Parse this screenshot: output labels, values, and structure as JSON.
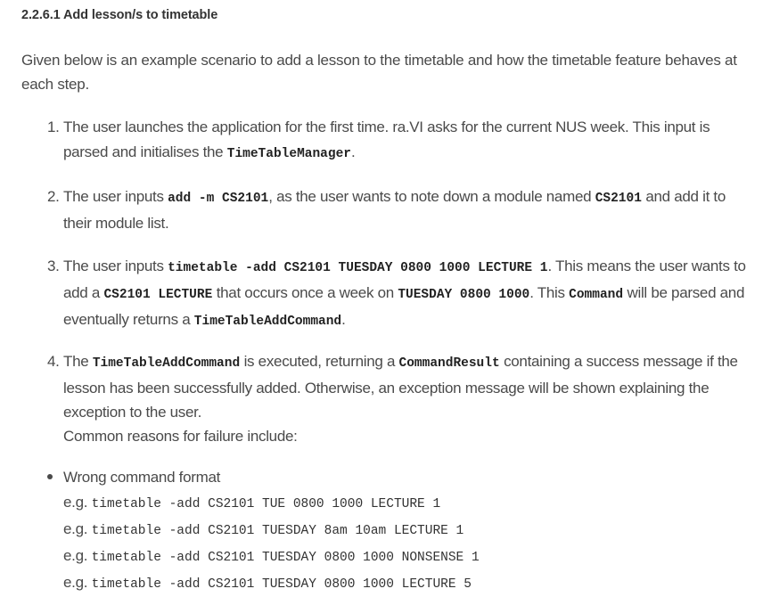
{
  "heading": "2.2.6.1 Add lesson/s to timetable",
  "intro": {
    "line1": "Given below is an example scenario to add a lesson to the timetable and how the timetable feature behaves at",
    "line2": "each step."
  },
  "steps": [
    {
      "num": "1.",
      "l1_text": "The user launches the application for the first time. ra.VI asks for the current NUS week. This input is",
      "l2_pre": "parsed and initialises the ",
      "l2_code": "TimeTableManager",
      "l2_post": "."
    },
    {
      "num": "2.",
      "l1_pre": "The user inputs ",
      "l1_code1": "add -m CS2101",
      "l1_mid": ", as the user wants to note down a module named ",
      "l1_code2": "CS2101",
      "l1_post": " and add it to",
      "l2_text": "their module list."
    },
    {
      "num": "3.",
      "l1_pre": "The user inputs ",
      "l1_code": "timetable -add CS2101 TUESDAY 0800 1000 LECTURE 1",
      "l1_post": ". This means the user wants to",
      "l2_pre": "add a ",
      "l2_code1": "CS2101 LECTURE",
      "l2_mid": " that occurs once a week on ",
      "l2_code2": "TUESDAY 0800 1000",
      "l2_mid2": ". This ",
      "l2_code3": "Command",
      "l2_post": " will be parsed and",
      "l3_pre": "eventually returns a ",
      "l3_code": "TimeTableAddCommand",
      "l3_post": "."
    },
    {
      "num": "4.",
      "l1_pre": "The ",
      "l1_code1": "TimeTableAddCommand",
      "l1_mid": " is executed, returning a ",
      "l1_code2": "CommandResult",
      "l1_post": " containing a success message if the",
      "l2_text": "lesson has been successfully added. Otherwise, an exception message will be shown explaining the",
      "l3_text": "exception to the user.",
      "l4_text": "Common reasons for failure include:"
    }
  ],
  "bullet": {
    "title": "Wrong command format",
    "eg_label": "e.g. ",
    "examples": [
      "timetable -add CS2101 TUE 0800 1000 LECTURE 1",
      "timetable -add CS2101 TUESDAY 8am 10am LECTURE 1",
      "timetable -add CS2101 TUESDAY 0800 1000 NONSENSE 1",
      "timetable -add CS2101 TUESDAY 0800 1000 LECTURE 5"
    ]
  }
}
